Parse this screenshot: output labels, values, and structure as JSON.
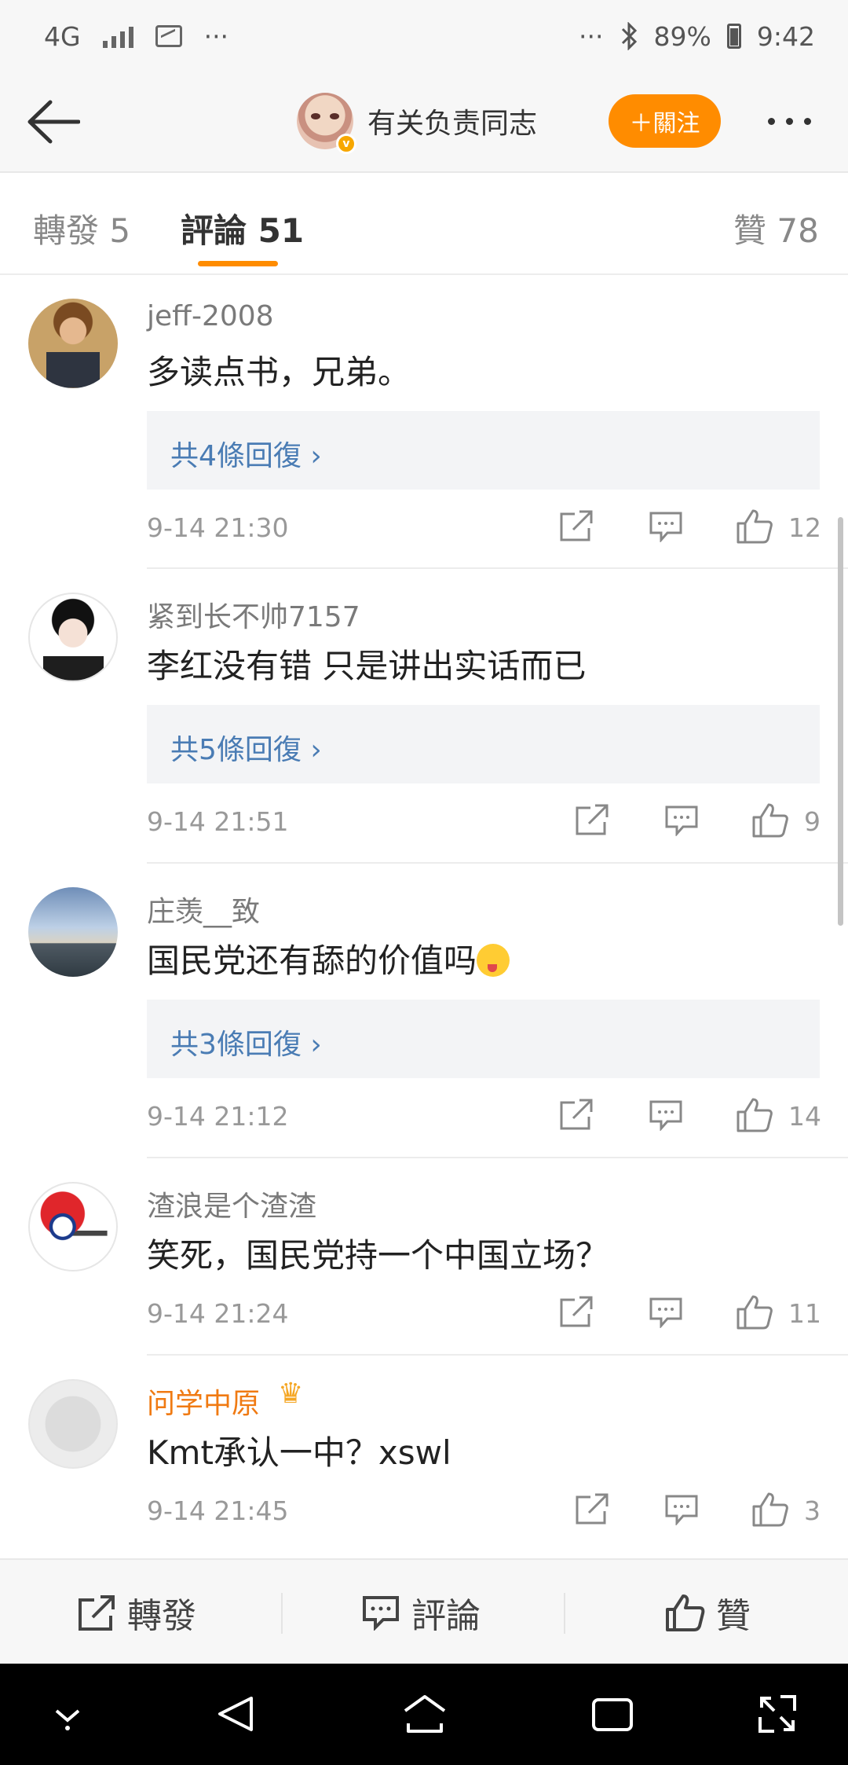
{
  "status_bar": {
    "network": "4G",
    "more_left": "···",
    "more_right": "···",
    "battery": "89%",
    "time": "9:42"
  },
  "header": {
    "author_name": "有关负责同志",
    "verified_badge": "v",
    "follow_label": "＋關注"
  },
  "tabs": {
    "repost": "轉發 5",
    "comments": "評論 51",
    "likes": "贊 78"
  },
  "comments": [
    {
      "user": "jeff-2008",
      "text": "多读点书，兄弟。",
      "replies": "共4條回復 ›",
      "time": "9-14 21:30",
      "likes": "12"
    },
    {
      "user": "紧到长不帅7157",
      "text": "李红没有错  只是讲出实话而已",
      "replies": "共5條回復 ›",
      "time": "9-14 21:51",
      "likes": "9"
    },
    {
      "user": "庄羡__致",
      "text": "国民党还有舔的价值吗",
      "emoji": "tongue-out-emoji",
      "replies": "共3條回復 ›",
      "time": "9-14 21:12",
      "likes": "14"
    },
    {
      "user": "渣浪是个渣渣",
      "text": "笑死，国民党持一个中国立场？",
      "time": "9-14 21:24",
      "likes": "11"
    },
    {
      "user": "问学中原",
      "user_badge": "crown-icon",
      "text": "Kmt承认一中？xswl",
      "time": "9-14 21:45",
      "likes": "3"
    }
  ],
  "bottom_bar": {
    "repost": "轉發",
    "comment": "評論",
    "like": "贊"
  },
  "colors": {
    "accent": "#ff8c00",
    "link": "#4a7cb4",
    "vip_name": "#f07a12"
  }
}
